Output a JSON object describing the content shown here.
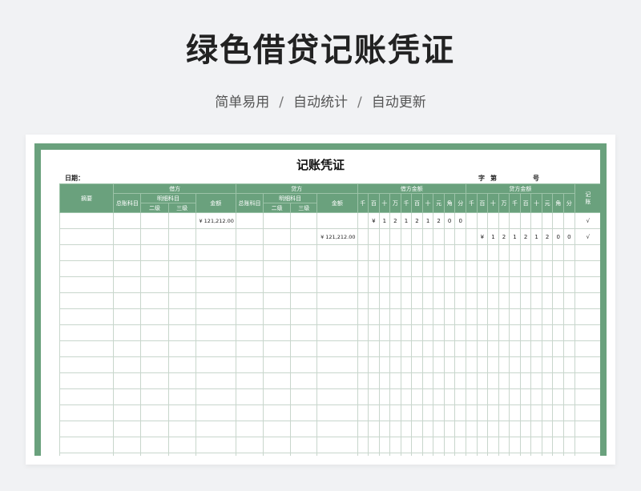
{
  "hero": {
    "title": "绿色借贷记账凭证",
    "sub_1": "简单易用",
    "sub_2": "自动统计",
    "sub_3": "自动更新",
    "separator": "/"
  },
  "voucher": {
    "title": "记账凭证",
    "date_label": "日期：",
    "zi_label": "字",
    "di_label": "第",
    "hao_label": "号"
  },
  "header": {
    "summary": "摘要",
    "debit": "借方",
    "credit": "贷方",
    "debit_amount_group": "借方金额",
    "credit_amount_group": "贷方金额",
    "posted": "记账",
    "general_account": "总账科目",
    "detail_account": "明细科目",
    "level2": "二级",
    "level3": "三级",
    "amount": "金额",
    "digits": [
      "千",
      "百",
      "十",
      "万",
      "千",
      "百",
      "十",
      "元",
      "角",
      "分"
    ]
  },
  "rows": [
    {
      "debit_amount": "¥ 121,212.00",
      "credit_amount": "",
      "debit_digits": [
        "",
        "¥",
        "1",
        "2",
        "1",
        "2",
        "1",
        "2",
        "0",
        "0"
      ],
      "credit_digits": [
        "",
        "",
        "",
        "",
        "",
        "",
        "",
        "",
        "",
        ""
      ],
      "posted": "√"
    },
    {
      "debit_amount": "",
      "credit_amount": "¥ 121,212.00",
      "debit_digits": [
        "",
        "",
        "",
        "",
        "",
        "",
        "",
        "",
        "",
        ""
      ],
      "credit_digits": [
        "",
        "¥",
        "1",
        "2",
        "1",
        "2",
        "1",
        "2",
        "0",
        "0"
      ],
      "posted": "√"
    }
  ],
  "empty_row_count": 14,
  "colors": {
    "accent": "#6aa17d",
    "divider_red": "#c8584f"
  }
}
